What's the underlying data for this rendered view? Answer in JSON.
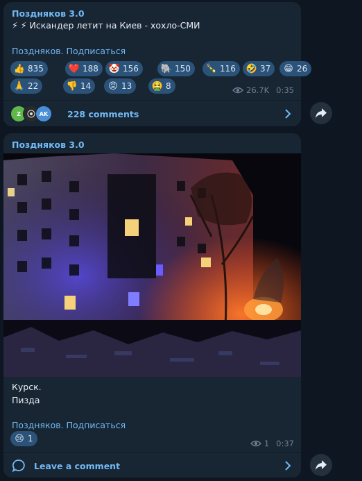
{
  "post1": {
    "channel": "Поздняков 3.0",
    "text": "⚡ ⚡ Искандер летит на Киев - хохло-СМИ",
    "subscribe_link": "Поздняков. Подписаться",
    "reactions": [
      {
        "emoji": "👍",
        "count": "835"
      },
      {
        "emoji": "❤️",
        "count": "188"
      },
      {
        "emoji": "🤡",
        "count": "156"
      },
      {
        "emoji": "🐘",
        "count": "150"
      },
      {
        "emoji": "🍾",
        "count": "116"
      },
      {
        "emoji": "🤣",
        "count": "37"
      },
      {
        "emoji": "😁",
        "count": "26"
      },
      {
        "emoji": "🙏",
        "count": "22"
      },
      {
        "emoji": "👎",
        "count": "14"
      },
      {
        "emoji": "😡",
        "count": "13"
      },
      {
        "emoji": "🤮",
        "count": "8"
      }
    ],
    "views": "26.7K",
    "time": "0:35",
    "commenters": [
      "Z",
      "",
      "AK"
    ],
    "comments": "228 comments"
  },
  "post2": {
    "channel": "Поздняков 3.0",
    "text_line1": "Курск.",
    "text_line2": "Пизда",
    "subscribe_link": "Поздняков. Подписаться",
    "reactions": [
      {
        "emoji": "😢",
        "count": "1"
      }
    ],
    "views": "1",
    "time": "0:37",
    "comments": "Leave a comment"
  },
  "icons": {
    "views": "eye-icon",
    "comments_chevron": "chevron-right-icon",
    "share": "share-arrow-icon",
    "comment_bubble": "comment-bubble-icon"
  },
  "colors": {
    "background": "#0e1621",
    "card": "#182533",
    "accent": "#71baf5",
    "reaction_pill": "#2b5278"
  }
}
